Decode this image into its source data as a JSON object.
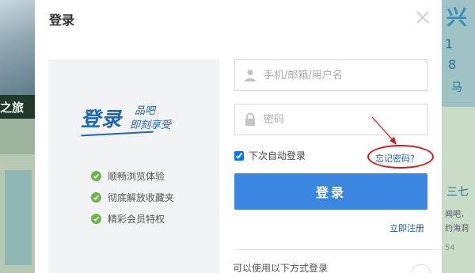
{
  "background": {
    "left_caption": "之旅",
    "right_logo": "兴",
    "right_numbers": [
      "1",
      "8",
      "马"
    ],
    "right_heading": "三七",
    "right_lines": [
      "闻吧，",
      "约海洞",
      "54"
    ]
  },
  "modal": {
    "title": "登录",
    "close_icon": "close-icon"
  },
  "promo": {
    "slogan_main": "登录",
    "slogan_sub1": "品吧",
    "slogan_sub2": "即刻享受",
    "benefits": [
      "顺畅浏览体验",
      "彻底解放收藏夹",
      "精彩会员特权"
    ]
  },
  "form": {
    "username_placeholder": "手机/邮箱/用户名",
    "password_placeholder": "密码",
    "remember_label": "下次自动登录",
    "remember_checked": true,
    "forgot_label": "忘记密码？",
    "login_label": "登录",
    "register_label": "立即注册",
    "other_login_label": "可以使用以下方式登录"
  },
  "colors": {
    "accent": "#3b86de",
    "link": "#1d5ca8",
    "check": "#6bb44a",
    "annotation": "#d21b1b"
  }
}
